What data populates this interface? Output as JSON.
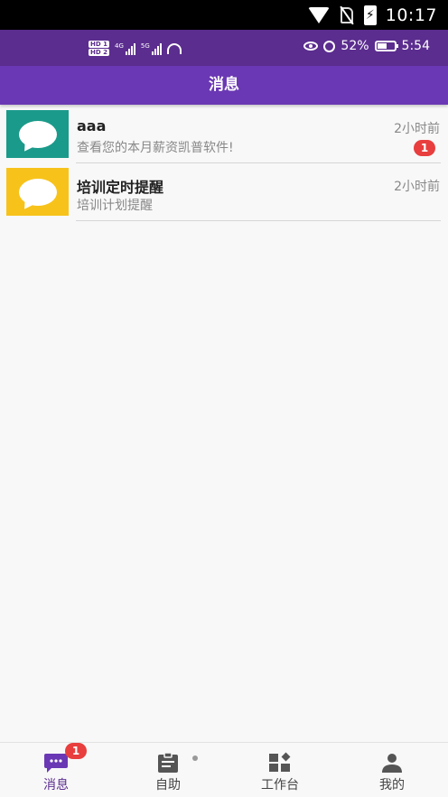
{
  "system_bar": {
    "time": "10:17"
  },
  "app_status": {
    "hd1": "HD 1",
    "hd2": "HD 2",
    "sig1_label": "4G",
    "sig2_label": "5G",
    "battery_percent": "52%",
    "time": "5:54"
  },
  "header": {
    "title": "消息"
  },
  "messages": [
    {
      "title": "aaa",
      "subtitle": "查看您的本月薪资凯普软件!",
      "time": "2小时前",
      "badge": "1",
      "avatar_color": "#1a9a8a",
      "icon": "chat-bubble-icon"
    },
    {
      "title": "培训定时提醒",
      "subtitle": "培训计划提醒",
      "time": "2小时前",
      "badge": "",
      "avatar_color": "#f7c31b",
      "icon": "chat-bubble-icon"
    }
  ],
  "nav": {
    "items": [
      {
        "label": "消息",
        "icon": "message-icon",
        "badge": "1",
        "active": true
      },
      {
        "label": "自助",
        "icon": "clipboard-icon",
        "active": false
      },
      {
        "label": "工作台",
        "icon": "workbench-icon",
        "active": false
      },
      {
        "label": "我的",
        "icon": "person-icon",
        "active": false
      }
    ]
  },
  "colors": {
    "primary": "#6a38b4",
    "status_purple": "#5b2d8f",
    "badge_red": "#e83e3e"
  }
}
